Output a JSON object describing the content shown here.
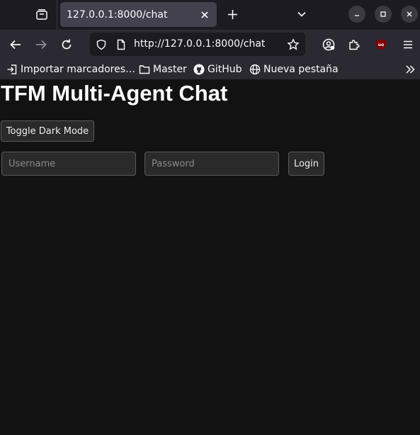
{
  "browser": {
    "tab": {
      "title": "127.0.0.1:8000/chat"
    },
    "address_bar": {
      "url": "http://127.0.0.1:8000/chat"
    },
    "bookmarks": [
      {
        "label": "Importar marcadores…",
        "icon": "import-icon"
      },
      {
        "label": "Master",
        "icon": "folder-icon"
      },
      {
        "label": "GitHub",
        "icon": "github-icon"
      },
      {
        "label": "Nueva pestaña",
        "icon": "globe-icon"
      }
    ],
    "colors": {
      "tabbar_bg": "#1c1b22",
      "toolbar_bg": "#2b2a33",
      "active_tab_bg": "#42414d",
      "ublock_red": "#800000"
    }
  },
  "page": {
    "title": "TFM Multi-Agent Chat",
    "toggle_dark_mode_label": "Toggle Dark Mode",
    "username_placeholder": "Username",
    "password_placeholder": "Password",
    "login_label": "Login",
    "colors": {
      "background": "#121212",
      "control_bg": "#2a2a2a",
      "control_border": "#5a5a5a"
    }
  }
}
